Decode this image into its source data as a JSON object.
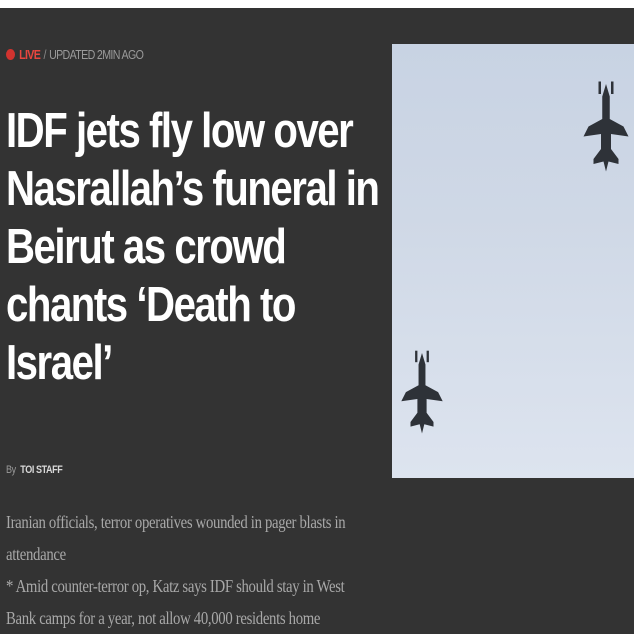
{
  "article": {
    "live_label": "LIVE",
    "separator": "/",
    "updated": "UPDATED 2MIN AGO",
    "headline": "IDF jets fly low over Nasrallah’s funeral in Beirut as crowd chants ‘Death to Israel’",
    "byline_prefix": "By",
    "byline_author": "TOI STAFF",
    "summary_1": "Iranian officials, terror operatives wounded in pager blasts in attendance",
    "summary_2": "* Amid counter-terror op, Katz says IDF should stay in West Bank camps for a year, not allow 40,000 residents home"
  },
  "photo": {
    "subject_icon": "fighter-jet-icon"
  },
  "colors": {
    "background": "#333333",
    "live_red": "#e8463f",
    "headline": "#ffffff",
    "summary": "#a8a8a8",
    "sky": "#cfd8e6"
  }
}
